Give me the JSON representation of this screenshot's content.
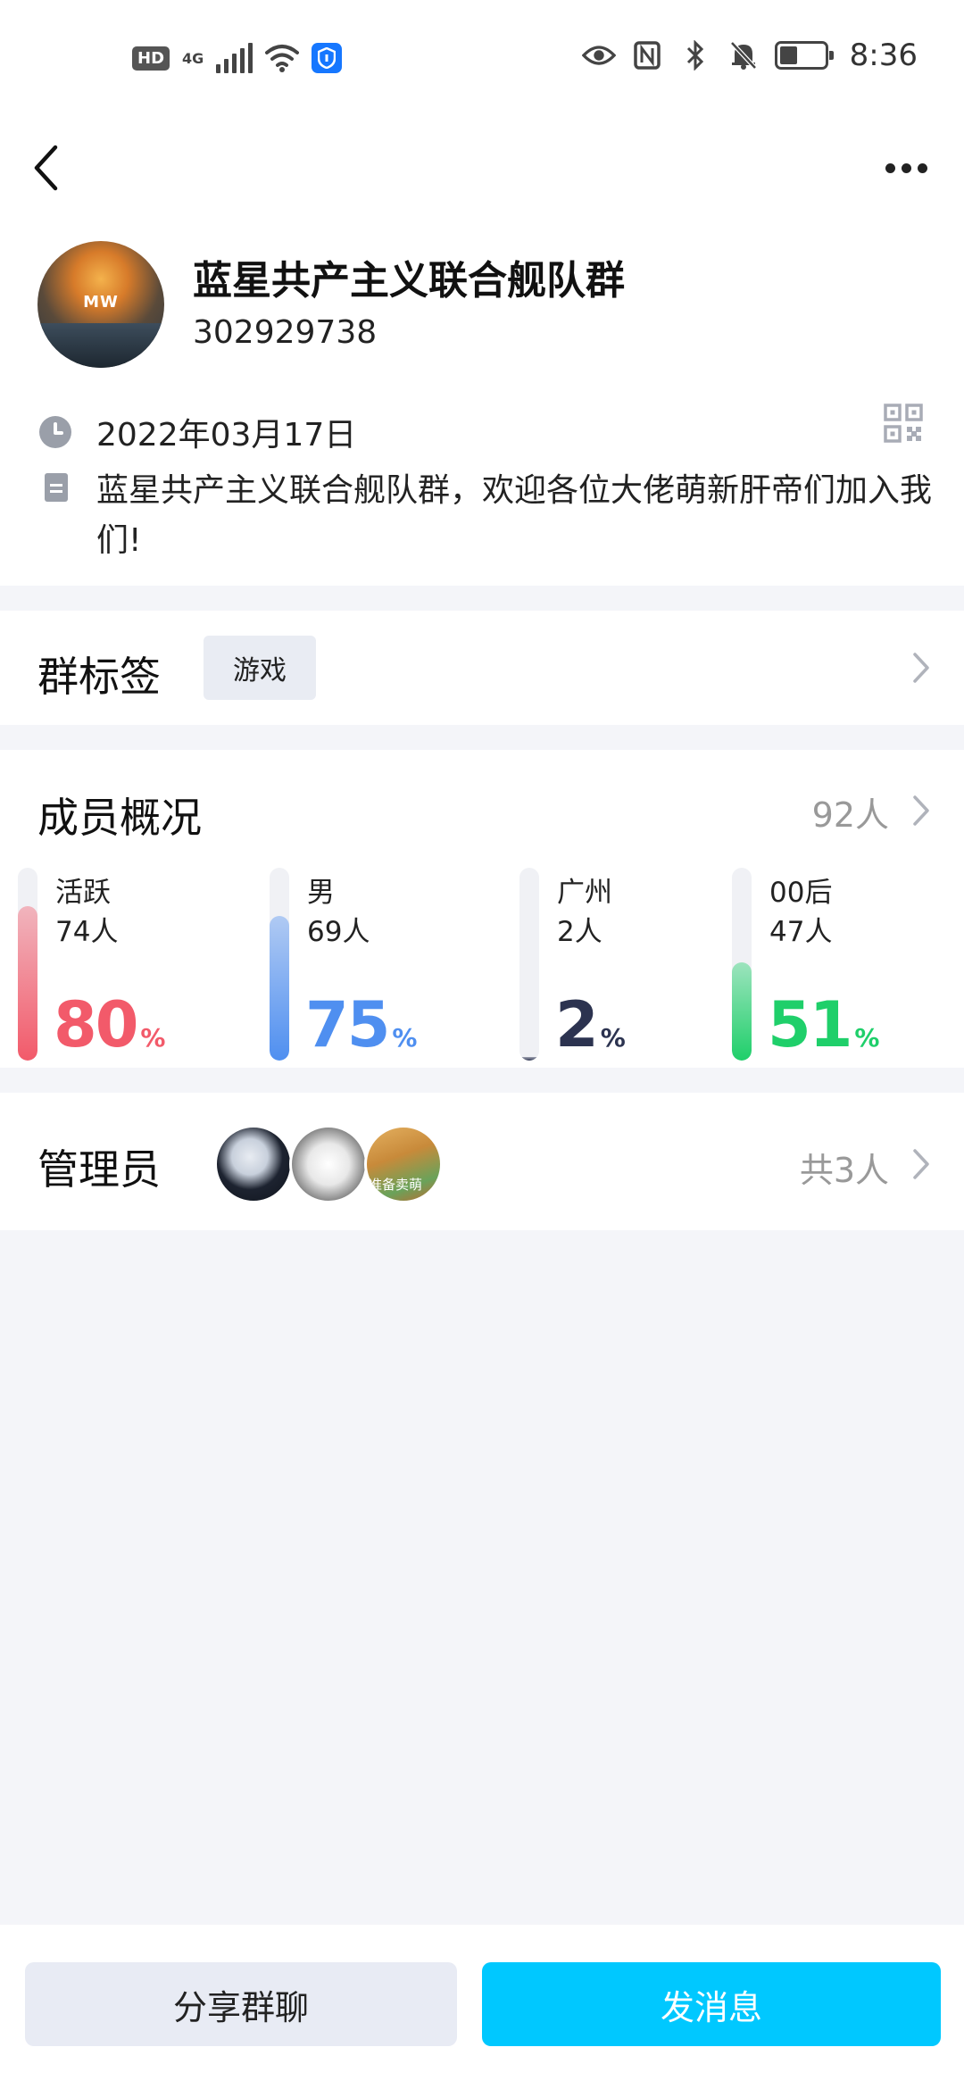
{
  "status_bar": {
    "hd": "HD",
    "network": "4G",
    "time": "8:36"
  },
  "nav": {
    "back_icon": "chevron-left-icon",
    "more_icon": "more-horizontal-icon"
  },
  "group": {
    "name": "蓝星共产主义联合舰队群",
    "id": "302929738",
    "created_date": "2022年03月17日",
    "description": "蓝星共产主义联合舰队群，欢迎各位大佬萌新肝帝们加入我们!",
    "avatar_text": "MW"
  },
  "tags": {
    "title": "群标签",
    "items": [
      "游戏"
    ]
  },
  "members": {
    "title": "成员概况",
    "total": "92人",
    "stats": [
      {
        "label": "活跃",
        "count": "74人",
        "percent": "80",
        "percent_sign": "%",
        "fraction": 0.8,
        "color": "#f25a6a"
      },
      {
        "label": "男",
        "count": "69人",
        "percent": "75",
        "percent_sign": "%",
        "fraction": 0.75,
        "color": "#4f8ff0"
      },
      {
        "label": "广州",
        "count": "2人",
        "percent": "2",
        "percent_sign": "%",
        "fraction": 0.02,
        "color": "#2c3350"
      },
      {
        "label": "00后",
        "count": "47人",
        "percent": "51",
        "percent_sign": "%",
        "fraction": 0.51,
        "color": "#1fcf6a"
      }
    ]
  },
  "admins": {
    "title": "管理员",
    "count": "共3人",
    "avatar3_text": "准备卖萌"
  },
  "actions": {
    "share_label": "分享群聊",
    "send_label": "发消息"
  }
}
